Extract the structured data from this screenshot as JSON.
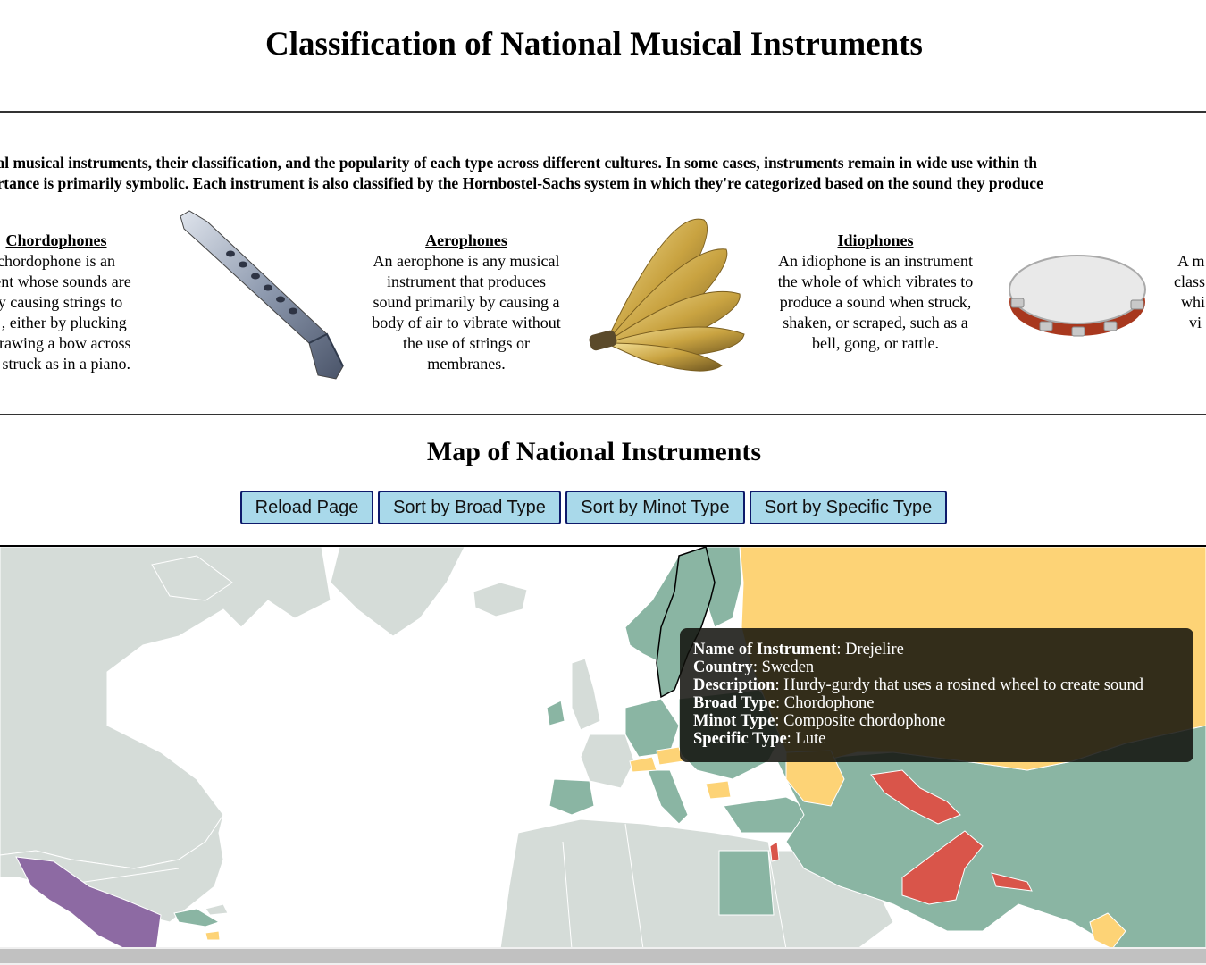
{
  "page": {
    "title": "Classification of National Musical Instruments"
  },
  "intro": {
    "line1": "onal musical instruments, their classification, and the popularity of each type across different cultures. In some cases, instruments remain in wide use within th",
    "line2": "portance is primarily symbolic. Each instrument is also classified by the Hornbostel-Sachs system in which they're categorized based on the sound they produce"
  },
  "types": [
    {
      "heading": "Chordophones",
      "lines": [
        "chordophone is an",
        "ment whose sounds are",
        "by causing strings to",
        "te , either by plucking",
        "r drawing a bow across",
        "nd struck as in a piano."
      ]
    },
    {
      "heading": "Aerophones",
      "lines": [
        "An aerophone is any musical",
        "instrument that produces",
        "sound primarily by causing a",
        "body of air to vibrate without",
        "the use of strings or",
        "membranes."
      ]
    },
    {
      "heading": "Idiophones",
      "lines": [
        "An idiophone is an instrument",
        "the whole of which vibrates to",
        "produce a sound when struck,",
        "shaken, or scraped, such as a",
        "bell, gong, or rattle."
      ]
    },
    {
      "heading": "",
      "lines": [
        "A m",
        "class",
        "whi",
        "vi"
      ]
    }
  ],
  "map_section": {
    "title": "Map of National Instruments",
    "buttons": [
      "Reload Page",
      "Sort by Broad Type",
      "Sort by Minot Type",
      "Sort by Specific Type"
    ]
  },
  "legend_colors": {
    "chordophone": "#8ab5a3",
    "aerophone": "#d9554a",
    "idiophone": "#fdd376",
    "membranophone": "#8d6aa3",
    "no_data": "#d5dcd8"
  },
  "tooltip": {
    "rows": [
      {
        "label": "Name of Instrument",
        "value": "Drejelire"
      },
      {
        "label": "Country",
        "value": "Sweden"
      },
      {
        "label": "Description",
        "value": "Hurdy-gurdy that uses a rosined wheel to create sound"
      },
      {
        "label": "Broad Type",
        "value": "Chordophone"
      },
      {
        "label": "Minot Type",
        "value": "Composite chordophone"
      },
      {
        "label": "Specific Type",
        "value": "Lute"
      }
    ]
  }
}
